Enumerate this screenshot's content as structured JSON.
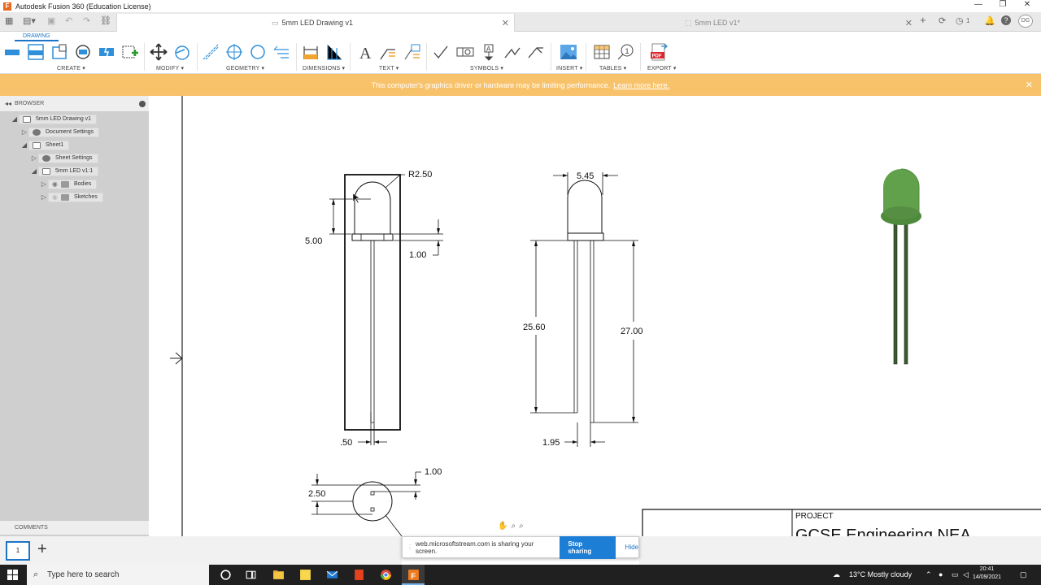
{
  "app": {
    "title": "Autodesk Fusion 360 (Education License)"
  },
  "tabs": [
    {
      "label": "5mm LED Drawing v1",
      "active": true
    },
    {
      "label": "5mm LED v1*",
      "active": false
    }
  ],
  "user": {
    "initials": "DG",
    "jobs_count": "1"
  },
  "ribbon": {
    "mode": "DRAWING",
    "groups": [
      "CREATE ▾",
      "MODIFY ▾",
      "GEOMETRY ▾",
      "DIMENSIONS ▾",
      "TEXT ▾",
      "SYMBOLS ▾",
      "INSERT ▾",
      "TABLES ▾",
      "EXPORT ▾"
    ]
  },
  "banner": {
    "text": "This computer's graphics driver or hardware may be limiting performance.",
    "link": "Learn more here."
  },
  "browser": {
    "title": "BROWSER",
    "items": [
      {
        "label": "5mm LED Drawing v1",
        "toggle": "◢",
        "icon": "drawing-icon"
      },
      {
        "label": "Document Settings",
        "toggle": "▷",
        "icon": "gear-icon"
      },
      {
        "label": "Sheet1",
        "toggle": "◢",
        "icon": "sheet-icon"
      },
      {
        "label": "Sheet Settings",
        "toggle": "▷",
        "icon": "gear-icon"
      },
      {
        "label": "5mm LED v1:1",
        "toggle": "◢",
        "icon": "view-icon"
      },
      {
        "label": "Bodies",
        "toggle": "▷",
        "icon": "folder-icon"
      },
      {
        "label": "Sketches",
        "toggle": "▷",
        "icon": "folder-icon"
      }
    ],
    "comments": "COMMENTS"
  },
  "drawing": {
    "dims": {
      "radius": "R2.50",
      "height": "5.00",
      "flange": "1.00",
      "lead_width": ".50",
      "width_top": "5.45",
      "lead_short": "25.60",
      "lead_long": "27.00",
      "lead_spacing": "1.95",
      "bottom_dia": "2.50",
      "bottom_flange": "1.00"
    },
    "title_block": {
      "label": "PROJECT",
      "project": "GCSE Engineering NEA"
    }
  },
  "sheet_tab": {
    "label": "1"
  },
  "share_bar": {
    "message": "web.microsoftstream.com is sharing your screen.",
    "stop": "Stop sharing",
    "hide": "Hide"
  },
  "taskbar": {
    "search_placeholder": "Type here to search",
    "weather": "13°C  Mostly cloudy",
    "time": "20:41",
    "date": "14/09/2021"
  }
}
